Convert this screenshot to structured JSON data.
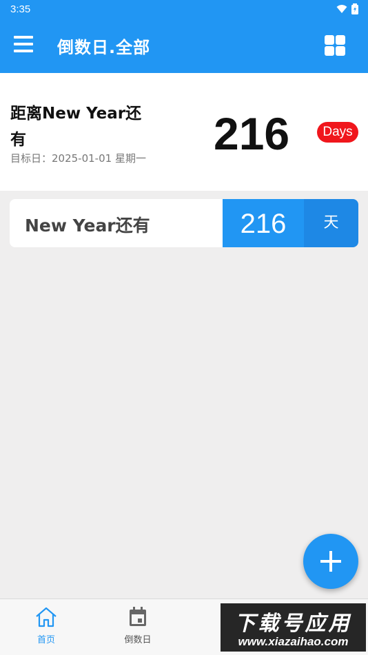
{
  "status_bar": {
    "time": "3:35"
  },
  "app_bar": {
    "title": "倒数日.全部"
  },
  "featured": {
    "title": "距离New Year还有",
    "target_date": "目标日：2025-01-01 星期一",
    "days": "216",
    "badge": "Days"
  },
  "events": [
    {
      "label": "New Year还有",
      "days": "216",
      "unit": "天"
    }
  ],
  "bottom_nav": {
    "items": [
      {
        "label": "首页",
        "icon": "home-icon",
        "active": true
      },
      {
        "label": "倒数日",
        "icon": "calendar-icon",
        "active": false
      }
    ]
  },
  "watermark": {
    "line1": "下载号应用",
    "line2": "www.xiazaihao.com"
  },
  "colors": {
    "primary": "#2196f3",
    "badge": "#f0161c",
    "background": "#efeeee"
  }
}
